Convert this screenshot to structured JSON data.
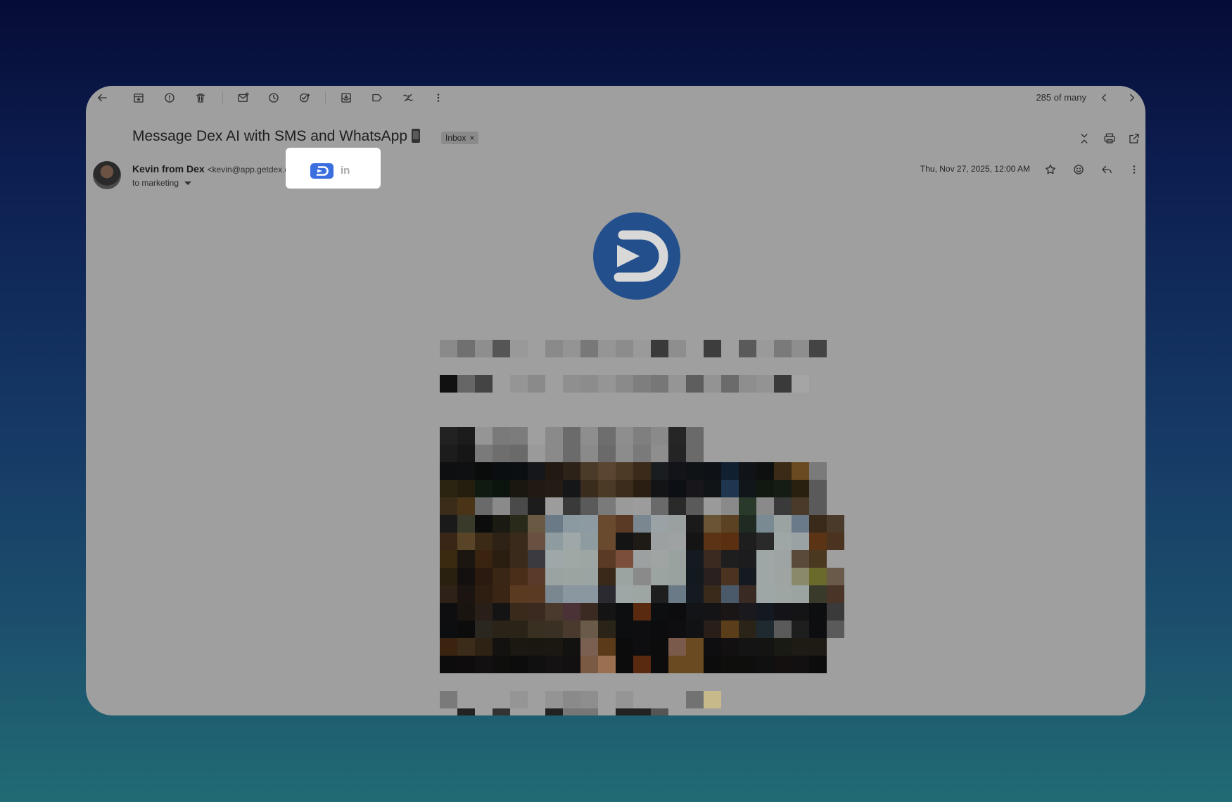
{
  "toolbar": {
    "icons": [
      "back-arrow-icon",
      "archive-icon",
      "report-spam-icon",
      "delete-icon",
      "mark-unread-icon",
      "snooze-icon",
      "add-task-icon",
      "move-to-icon",
      "label-icon",
      "filter-icon",
      "more-icon"
    ],
    "counter": "285 of many"
  },
  "email": {
    "subject": "Message Dex AI with SMS and WhatsApp",
    "label_chip": "Inbox",
    "label_chip_close": "×",
    "sender_name": "Kevin from Dex",
    "sender_email": "<kevin@app.getdex.com>",
    "to_line": "to marketing",
    "date": "Thu, Nov 27, 2025, 12:00 AM",
    "linkedin_label": "in"
  },
  "colors": {
    "window_overlay": "#9f9f9f",
    "dex_logo_blue": "#234f8d",
    "dex_badge_blue": "#3b6fe0",
    "highlight_box": "#ffffff"
  }
}
